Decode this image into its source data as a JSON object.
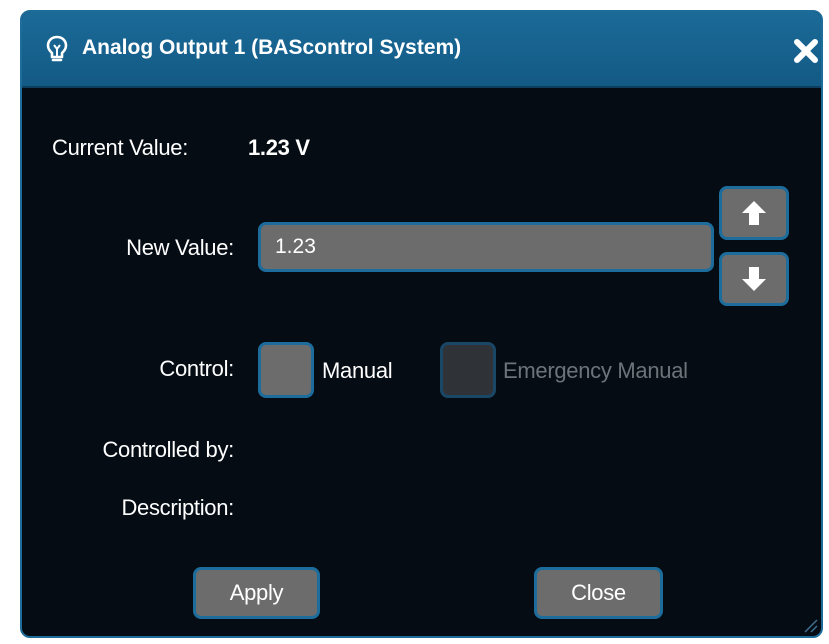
{
  "window": {
    "title": "Analog Output 1 (BAScontrol System)",
    "title_icon": "lightbulb-icon",
    "close_icon": "close-icon"
  },
  "current_value": {
    "label": "Current Value:",
    "value": "1.23 V"
  },
  "new_value": {
    "label": "New Value:",
    "value": "1.23",
    "increment_icon": "arrow-up-icon",
    "decrement_icon": "arrow-down-icon"
  },
  "control": {
    "label": "Control:",
    "manual_label": "Manual",
    "manual_checked": false,
    "emergency_label": "Emergency Manual",
    "emergency_checked": false,
    "emergency_enabled": false
  },
  "controlled_by": {
    "label": "Controlled by:",
    "value": ""
  },
  "description": {
    "label": "Description:",
    "value": ""
  },
  "buttons": {
    "apply_label": "Apply",
    "close_label": "Close"
  },
  "colors": {
    "titlebar": "#1b6a98",
    "background": "#050c14",
    "control_fill": "#6c6c6c",
    "control_border": "#1d6d9c",
    "disabled_text": "#6e737a"
  }
}
